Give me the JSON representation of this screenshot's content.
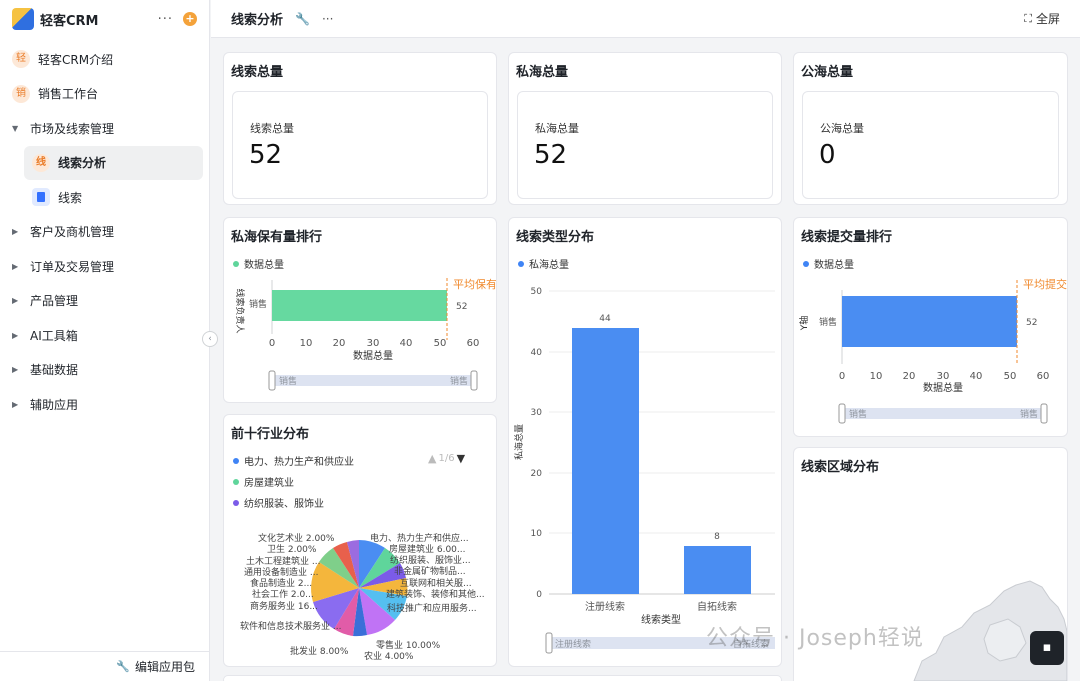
{
  "brand": {
    "name": "轻客CRM"
  },
  "sidebar": {
    "items": [
      {
        "label": "轻客CRM介绍",
        "badge": "轻"
      },
      {
        "label": "销售工作台",
        "badge": "销"
      },
      {
        "label": "市场及线索管理"
      },
      {
        "label": "线索分析",
        "badge": "线"
      },
      {
        "label": "线索"
      },
      {
        "label": "客户及商机管理"
      },
      {
        "label": "订单及交易管理"
      },
      {
        "label": "产品管理"
      },
      {
        "label": "AI工具箱"
      },
      {
        "label": "基础数据"
      },
      {
        "label": "辅助应用"
      }
    ],
    "footer": "编辑应用包"
  },
  "header": {
    "title": "线索分析",
    "fullscreen": "全屏"
  },
  "cards": {
    "clue_total": {
      "title": "线索总量",
      "label": "线索总量",
      "value": "52"
    },
    "private_total": {
      "title": "私海总量",
      "label": "私海总量",
      "value": "52"
    },
    "public_total": {
      "title": "公海总量",
      "label": "公海总量",
      "value": "0"
    },
    "private_rank": {
      "title": "私海保有量排行",
      "legend": "数据总量",
      "y_axis_title": "线索负责人",
      "x_axis_title": "数据总量",
      "category": "销售",
      "value_label": "52",
      "avg_label": "平均保有",
      "ticks": [
        "0",
        "10",
        "20",
        "30",
        "40",
        "50",
        "60"
      ],
      "slider_left": "销售",
      "slider_right": "销售"
    },
    "clue_type": {
      "title": "线索类型分布",
      "legend": "私海总量",
      "y_axis_title": "私海总量",
      "x_axis_title": "线索类型",
      "y_ticks": [
        "50",
        "40",
        "30",
        "20",
        "10",
        "0"
      ],
      "bar1_cat": "注册线索",
      "bar1_val": "44",
      "bar2_cat": "自拓线索",
      "bar2_val": "8",
      "slider_left": "注册线索",
      "slider_right": "自拓线索"
    },
    "submit_rank": {
      "title": "线索提交量排行",
      "legend": "数据总量",
      "y_axis_title": "Y轴",
      "x_axis_title": "数据总量",
      "category": "销售",
      "value_label": "52",
      "avg_label": "平均提交",
      "ticks": [
        "0",
        "10",
        "20",
        "30",
        "40",
        "50",
        "60"
      ],
      "slider_left": "销售",
      "slider_right": "销售"
    },
    "industry": {
      "title": "前十行业分布",
      "legend": [
        "电力、热力生产和供应业",
        "房屋建筑业",
        "纺织服装、服饰业"
      ],
      "pager": "1/6",
      "pie_labels": {
        "l1": "文化艺术业 2.00%",
        "l2": "卫生 2.00%",
        "l3": "土木工程建筑业 ...",
        "l4": "通用设备制造业 ...",
        "l5": "食品制造业 2...",
        "l6": "社会工作 2.0...",
        "l7": "商务服务业 16...",
        "l8": "软件和信息技术服务业 ...",
        "l9": "批发业 8.00%",
        "r1": "电力、热力生产和供应...",
        "r2": "房屋建筑业 6.00...",
        "r3": "纺织服装、服饰业...",
        "r4": "非金属矿物制品...",
        "r5": "互联网和相关服...",
        "r6": "建筑装饰、装修和其他...",
        "r7": "科技推广和应用服务...",
        "r8": "零售业 10.00%",
        "r9": "农业 4.00%"
      }
    },
    "region": {
      "title": "线索区域分布"
    }
  },
  "watermark": "公众号 · Joseph轻说",
  "chart_data": [
    {
      "type": "bar",
      "title": "私海保有量排行",
      "categories": [
        "销售"
      ],
      "values": [
        52
      ],
      "xlabel": "数据总量",
      "ylabel": "线索负责人",
      "xlim": [
        0,
        60
      ]
    },
    {
      "type": "bar",
      "title": "线索类型分布",
      "categories": [
        "注册线索",
        "自拓线索"
      ],
      "values": [
        44,
        8
      ],
      "xlabel": "线索类型",
      "ylabel": "私海总量",
      "ylim": [
        0,
        50
      ]
    },
    {
      "type": "bar",
      "title": "线索提交量排行",
      "categories": [
        "销售"
      ],
      "values": [
        52
      ],
      "xlabel": "数据总量",
      "ylabel": "Y轴",
      "xlim": [
        0,
        60
      ]
    },
    {
      "type": "pie",
      "title": "前十行业分布",
      "labels": [
        "文化艺术业",
        "卫生",
        "零售业",
        "农业",
        "批发业",
        "房屋建筑业"
      ],
      "values": [
        2,
        2,
        10,
        4,
        8,
        6
      ]
    }
  ]
}
